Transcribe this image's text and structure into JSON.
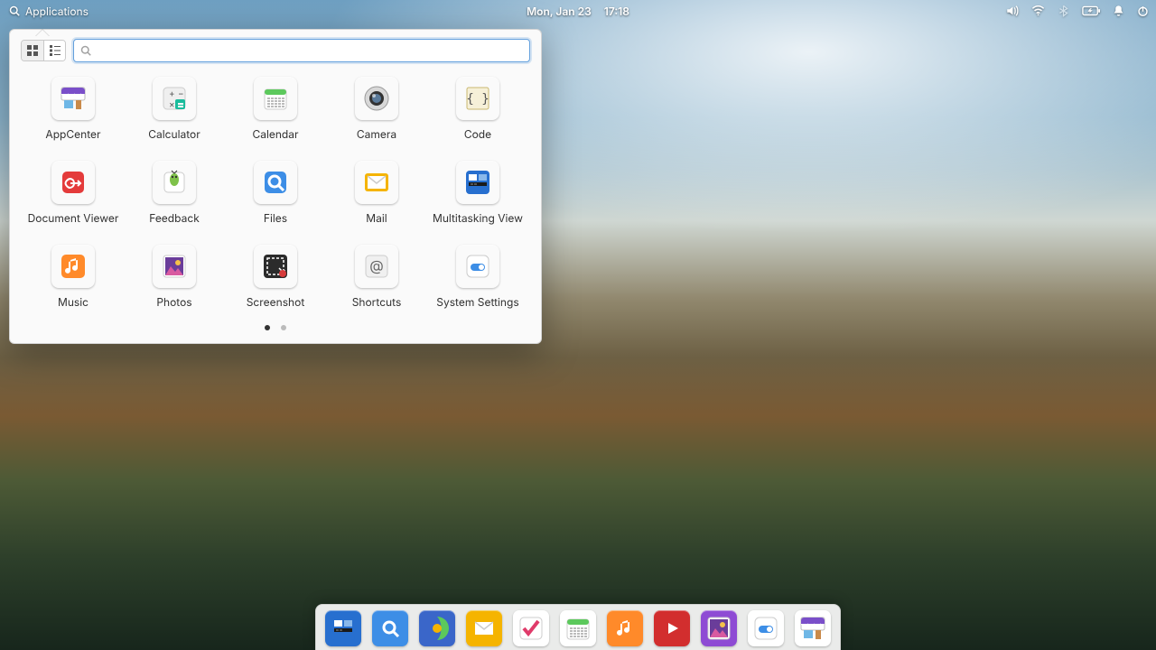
{
  "panel": {
    "apps_label": "Applications",
    "date": "Mon, Jan 23",
    "time": "17:18"
  },
  "popover": {
    "search_placeholder": "",
    "pages": 2,
    "active_page": 1
  },
  "apps": [
    {
      "label": "AppCenter",
      "name": "appcenter",
      "bg": "#ffffff"
    },
    {
      "label": "Calculator",
      "name": "calculator",
      "bg": "#f3f3f3"
    },
    {
      "label": "Calendar",
      "name": "calendar",
      "bg": "#ffffff"
    },
    {
      "label": "Camera",
      "name": "camera",
      "bg": "#ffffff"
    },
    {
      "label": "Code",
      "name": "code",
      "bg": "#f6f0d8"
    },
    {
      "label": "Document Viewer",
      "name": "document-viewer",
      "bg": "#e43b3b"
    },
    {
      "label": "Feedback",
      "name": "feedback",
      "bg": "#ffffff"
    },
    {
      "label": "Files",
      "name": "files",
      "bg": "#3d8ee6"
    },
    {
      "label": "Mail",
      "name": "mail",
      "bg": "#f5b400"
    },
    {
      "label": "Multitasking View",
      "name": "multitasking-view",
      "bg": "#276fcf"
    },
    {
      "label": "Music",
      "name": "music",
      "bg": "#ff8a2a"
    },
    {
      "label": "Photos",
      "name": "photos",
      "bg": "#ffffff"
    },
    {
      "label": "Screenshot",
      "name": "screenshot",
      "bg": "#2b2b2b"
    },
    {
      "label": "Shortcuts",
      "name": "shortcuts",
      "bg": "#f0f0f0"
    },
    {
      "label": "System Settings",
      "name": "system-settings",
      "bg": "#ffffff"
    }
  ],
  "dock": [
    {
      "name": "multitasking-view",
      "bg": "#276fcf"
    },
    {
      "name": "files",
      "bg": "#3d8ee6"
    },
    {
      "name": "web-browser",
      "bg": "#3a66c9"
    },
    {
      "name": "mail",
      "bg": "#f5b400"
    },
    {
      "name": "tasks",
      "bg": "#ffffff"
    },
    {
      "name": "calendar",
      "bg": "#ffffff"
    },
    {
      "name": "music",
      "bg": "#ff8a2a"
    },
    {
      "name": "videos",
      "bg": "#d22e2e"
    },
    {
      "name": "photos",
      "bg": "#8e4bd4"
    },
    {
      "name": "system-settings",
      "bg": "#ffffff"
    },
    {
      "name": "appcenter",
      "bg": "#ffffff"
    }
  ]
}
